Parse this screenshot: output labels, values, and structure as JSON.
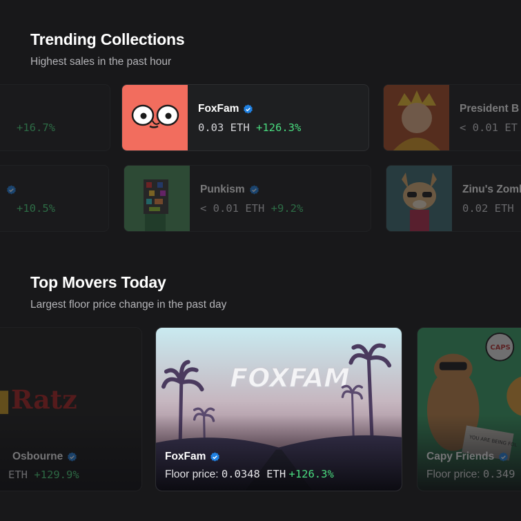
{
  "trending": {
    "title": "Trending Collections",
    "subtitle": "Highest sales in the past hour",
    "cards": [
      {
        "name": "",
        "price": "",
        "change": "+16.7%"
      },
      {
        "name": "FoxFam",
        "price": "0.03 ETH",
        "change": "+126.3%"
      },
      {
        "name": "President B",
        "price": "< 0.01 ET",
        "change": ""
      },
      {
        "name": "",
        "price": "",
        "change": "+10.5%"
      },
      {
        "name": "Punkism",
        "price": "< 0.01 ETH",
        "change": "+9.2%"
      },
      {
        "name": "Zinu's Zomb",
        "price": "0.02 ETH",
        "change": ""
      }
    ]
  },
  "movers": {
    "title": "Top Movers Today",
    "subtitle": "Largest floor price change in the past day",
    "cards": [
      {
        "name": "Osbourne",
        "price_label": "",
        "price": "ETH",
        "change": "+129.9%",
        "art_text": "Ratz"
      },
      {
        "name": "FoxFam",
        "price_label": "Floor price: ",
        "price": "0.0348 ETH",
        "change": "+126.3%",
        "art_text": "FOXFAM"
      },
      {
        "name": "Capy Friends",
        "price_label": "Floor price: ",
        "price": "0.349",
        "change": "",
        "art_text": "CAPS",
        "art_sign": "YOU ARE BEING FOL"
      }
    ]
  },
  "colors": {
    "background": "#18181a",
    "positive": "#4ade80",
    "verified": "#2081e2"
  }
}
